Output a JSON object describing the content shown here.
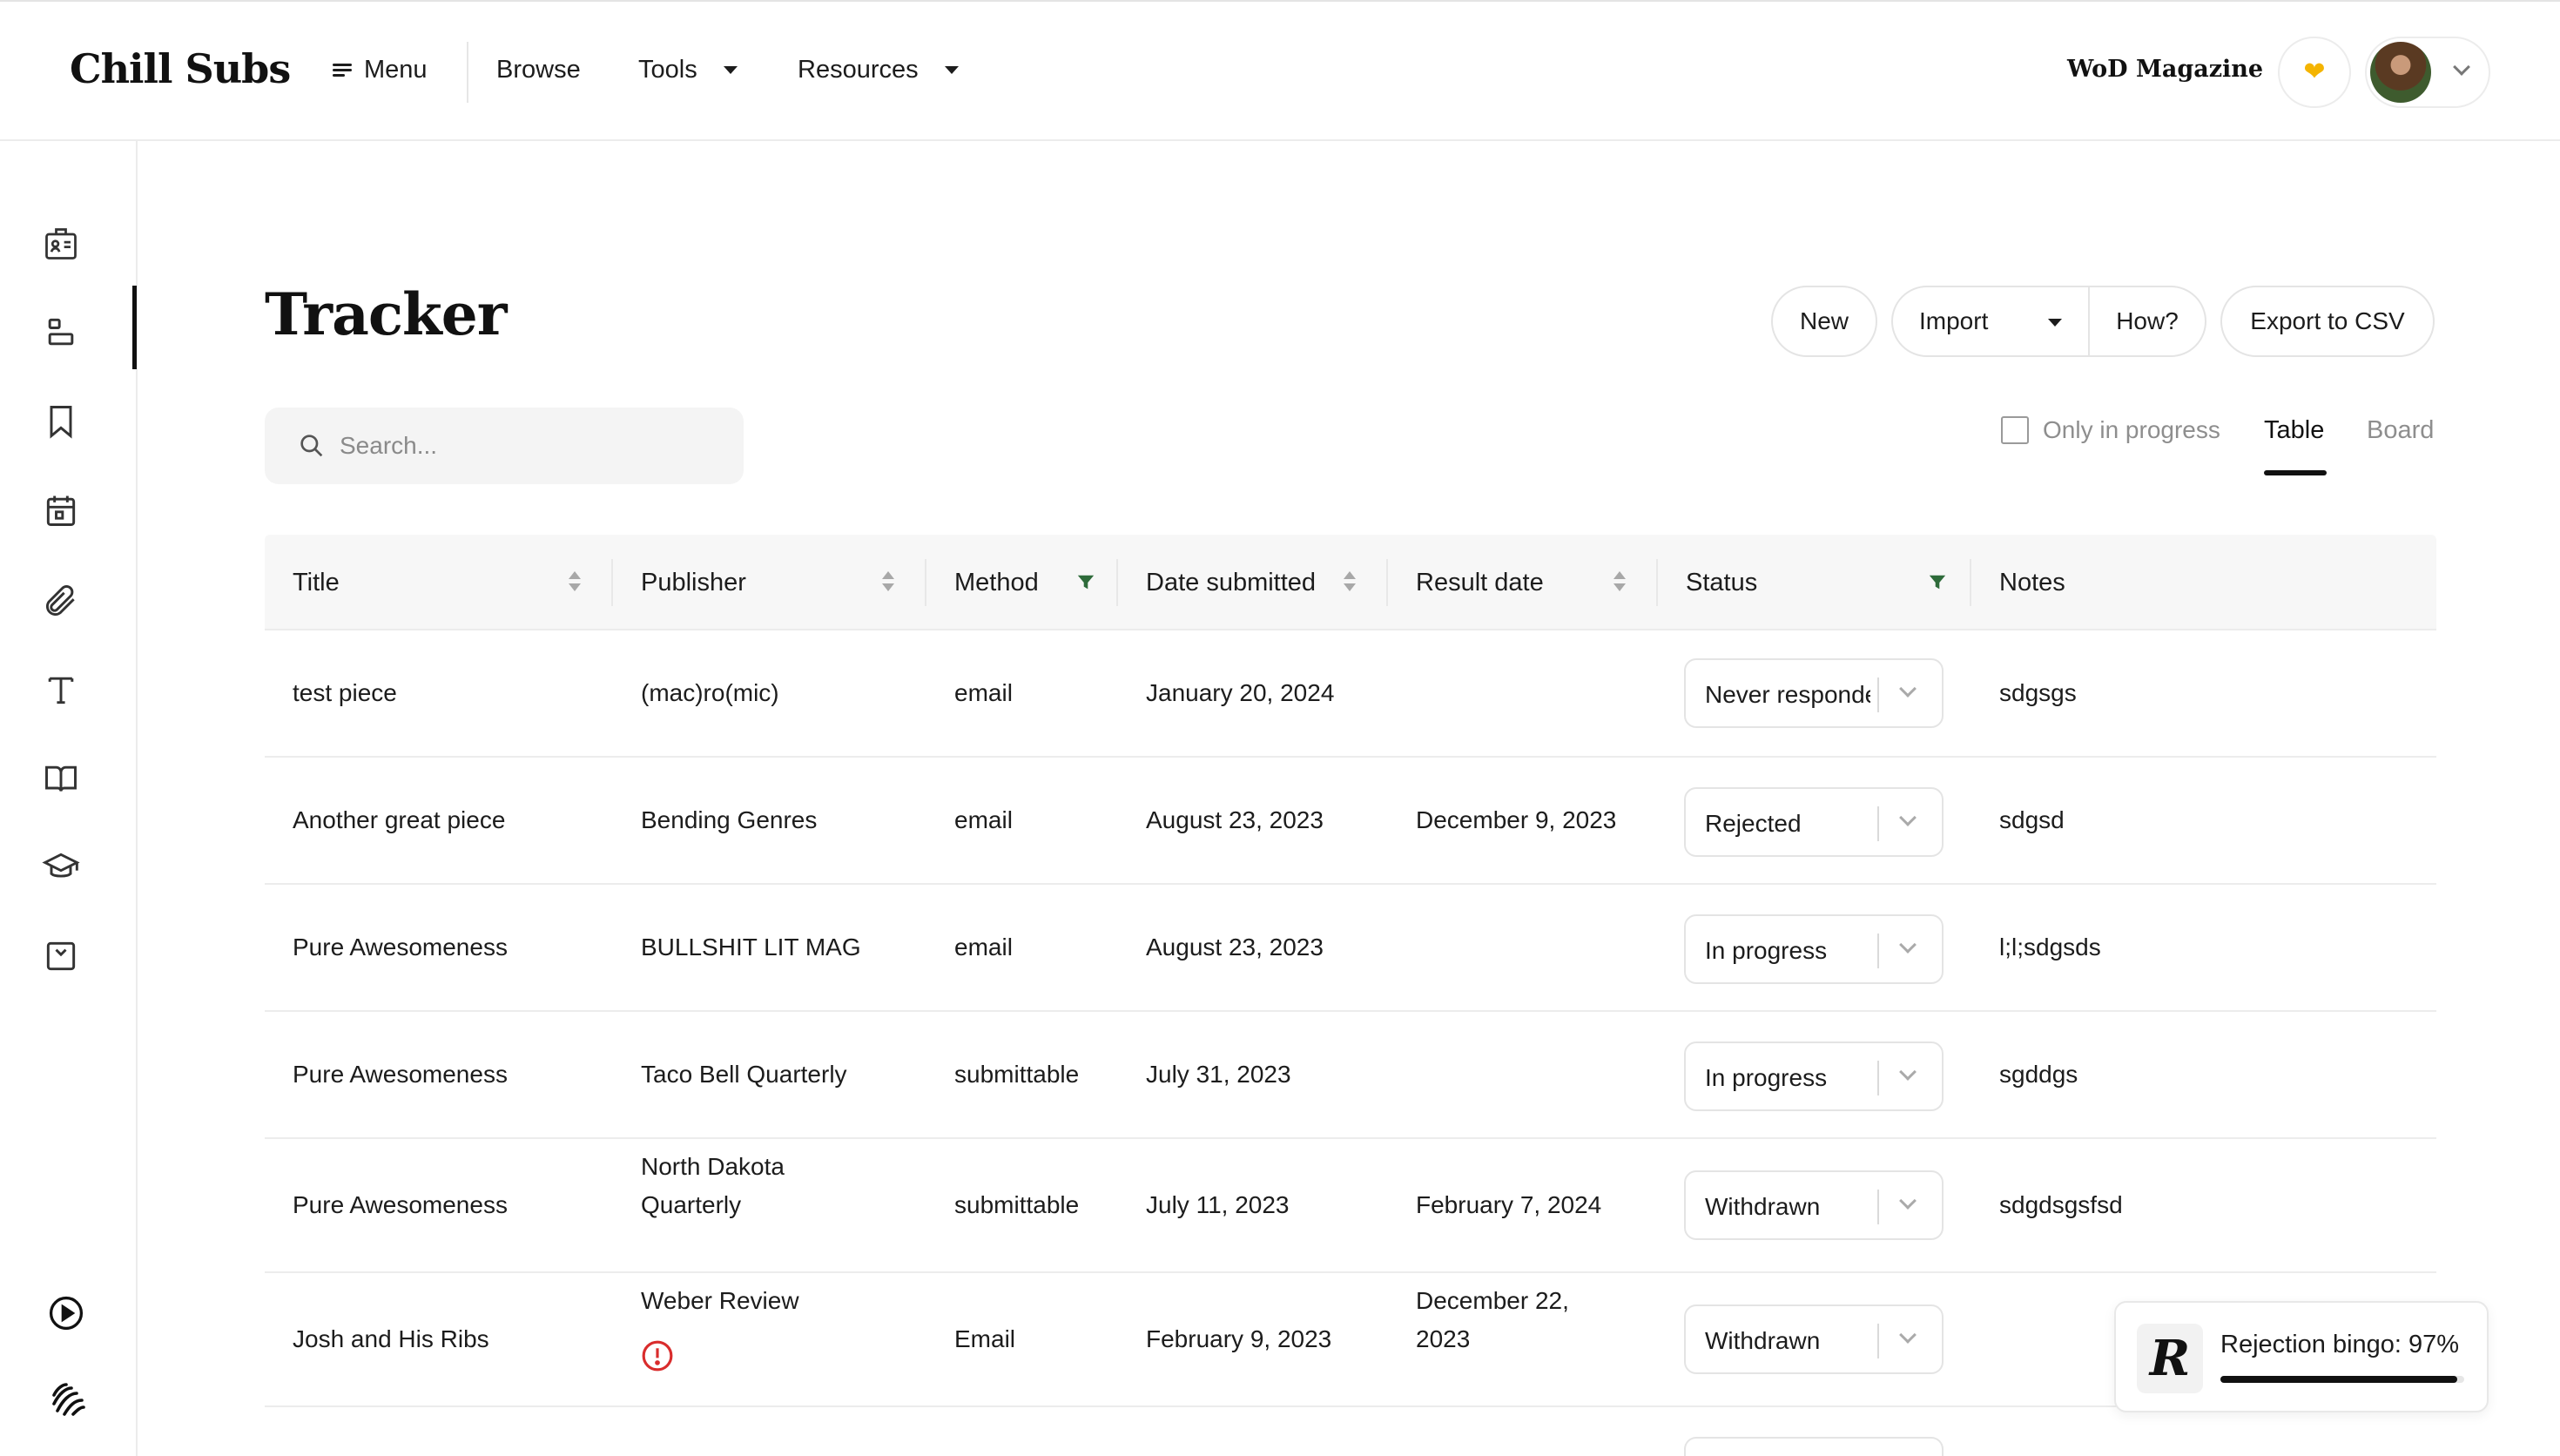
{
  "header": {
    "logo": "Chill Subs",
    "nav": {
      "menu": "Menu",
      "browse": "Browse",
      "tools": "Tools",
      "resources": "Resources"
    },
    "magazine": "WoD Magazine",
    "accent_color": "#f4b400"
  },
  "sidebar": {
    "items": [
      {
        "icon": "id-card-icon"
      },
      {
        "icon": "tracker-icon",
        "active": true
      },
      {
        "icon": "bookmark-icon"
      },
      {
        "icon": "calendar-icon"
      },
      {
        "icon": "paperclip-icon"
      },
      {
        "icon": "text-icon"
      },
      {
        "icon": "book-icon"
      },
      {
        "icon": "graduation-cap-icon"
      },
      {
        "icon": "inbox-icon"
      }
    ],
    "bottom": [
      {
        "icon": "play-icon"
      },
      {
        "icon": "chill-subs-mark-icon"
      }
    ]
  },
  "page": {
    "title": "Tracker",
    "actions": {
      "new": "New",
      "import": "Import",
      "how": "How?",
      "export": "Export to CSV"
    },
    "search": {
      "placeholder": "Search...",
      "value": ""
    },
    "filters": {
      "only_in_progress": "Only in progress",
      "only_in_progress_checked": false
    },
    "views": {
      "table": "Table",
      "board": "Board",
      "active": "Table"
    }
  },
  "table": {
    "columns": {
      "title": "Title",
      "publisher": "Publisher",
      "method": "Method",
      "date_submitted": "Date submitted",
      "result_date": "Result date",
      "status": "Status",
      "notes": "Notes"
    },
    "rows": [
      {
        "title": "test piece",
        "publisher": "(mac)ro(mic)",
        "method": "email",
        "date_submitted": "January 20, 2024",
        "result_date": "",
        "status": "Never responded",
        "notes": "sdgsgs"
      },
      {
        "title": "Another great piece",
        "publisher": "Bending Genres",
        "method": "email",
        "date_submitted": "August 23, 2023",
        "result_date": "December 9, 2023",
        "status": "Rejected",
        "notes": "sdgsd"
      },
      {
        "title": "Pure Awesomeness",
        "publisher": "BULLSHIT LIT MAG",
        "method": "email",
        "date_submitted": "August 23, 2023",
        "result_date": "",
        "status": "In progress",
        "notes": "l;l;sdgsds"
      },
      {
        "title": "Pure Awesomeness",
        "publisher": "Taco Bell Quarterly",
        "method": "submittable",
        "date_submitted": "July 31, 2023",
        "result_date": "",
        "status": "In progress",
        "notes": "sgddgs"
      },
      {
        "title": "Pure Awesomeness",
        "publisher_line1": "North Dakota",
        "publisher_line2": "Quarterly",
        "method": "submittable",
        "date_submitted": "July 11, 2023",
        "result_date": "February 7, 2024",
        "status": "Withdrawn",
        "notes": "sdgdsgsfsd"
      },
      {
        "title": "Josh and His Ribs",
        "publisher": "Weber Review",
        "publisher_alert": "alert-circle-icon",
        "method": "Email",
        "date_submitted": "February 9, 2023",
        "result_date_line1": "December 22,",
        "result_date_line2": "2023",
        "status": "Withdrawn",
        "notes": ""
      }
    ]
  },
  "bingo": {
    "badge": "R",
    "label": "Rejection bingo: 97%",
    "progress": 0.97
  }
}
